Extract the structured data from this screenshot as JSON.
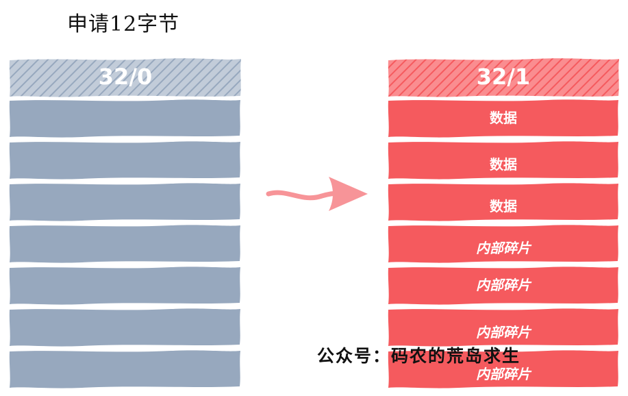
{
  "title": "申请12字节",
  "left_block": {
    "header": "32/0",
    "rows": 7
  },
  "right_block": {
    "header": "32/1",
    "rows": [
      {
        "label": "数据",
        "kind": "data"
      },
      {
        "label": "数据",
        "kind": "data"
      },
      {
        "label": "数据",
        "kind": "data"
      },
      {
        "label": "内部碎片",
        "kind": "fragment"
      },
      {
        "label": "内部碎片",
        "kind": "fragment"
      },
      {
        "label": "内部碎片",
        "kind": "fragment"
      },
      {
        "label": "内部碎片",
        "kind": "fragment"
      }
    ]
  },
  "watermark": "公众号：码农的荒岛求生",
  "colors": {
    "free": "#97a8be",
    "used": "#f55a5e",
    "arrow": "#f79498"
  }
}
